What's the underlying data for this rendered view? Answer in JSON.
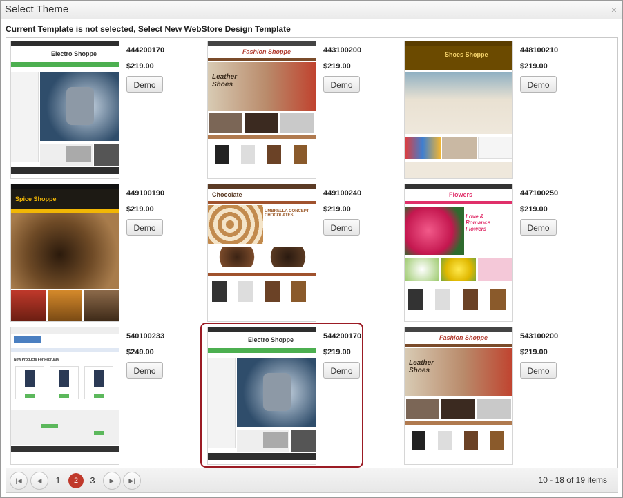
{
  "dialog": {
    "title": "Select Theme",
    "close_glyph": "×",
    "subtitle": "Current Template is not selected, Select New WebStore Design Template"
  },
  "templates": [
    {
      "code": "444200170",
      "price": "$219.00",
      "demo": "Demo",
      "logo": "Electro Shoppe",
      "theme": "electro"
    },
    {
      "code": "443100200",
      "price": "$219.00",
      "demo": "Demo",
      "logo": "Fashion Shoppe",
      "theme": "fashion",
      "banner": "Leather Shoes"
    },
    {
      "code": "448100210",
      "price": "$219.00",
      "demo": "Demo",
      "logo": "Shoes Shoppe",
      "theme": "shoes"
    },
    {
      "code": "449100190",
      "price": "$219.00",
      "demo": "Demo",
      "logo": "Spice Shoppe",
      "theme": "spice"
    },
    {
      "code": "449100240",
      "price": "$219.00",
      "demo": "Demo",
      "logo": "Chocolate",
      "theme": "choco",
      "banner": "UMBRELLA CONCEPT CHOCOLATES"
    },
    {
      "code": "447100250",
      "price": "$219.00",
      "demo": "Demo",
      "logo": "Flowers",
      "theme": "flowers",
      "banner": "Love & Romance Flowers"
    },
    {
      "code": "540100233",
      "price": "$249.00",
      "demo": "Demo",
      "logo": "",
      "theme": "basic",
      "banner": "New Products For February"
    },
    {
      "code": "544200170",
      "price": "$219.00",
      "demo": "Demo",
      "logo": "Electro Shoppe",
      "theme": "electro",
      "selected": true
    },
    {
      "code": "543100200",
      "price": "$219.00",
      "demo": "Demo",
      "logo": "Fashion Shoppe",
      "theme": "fashion",
      "banner": "Leather Shoes"
    }
  ],
  "pager": {
    "first": "|◀",
    "prev": "◀",
    "next": "▶",
    "last": "▶|",
    "pages": [
      "1",
      "2",
      "3"
    ],
    "current": "2",
    "summary": "10 - 18 of 19 items"
  },
  "colors": {
    "selected_border": "#9b1b24",
    "active_page": "#c0392b",
    "electro_green": "#4caf50",
    "spice_black": "#1d1a14",
    "choco_brown": "#a0522d",
    "flowers_pink": "#e0306a"
  }
}
